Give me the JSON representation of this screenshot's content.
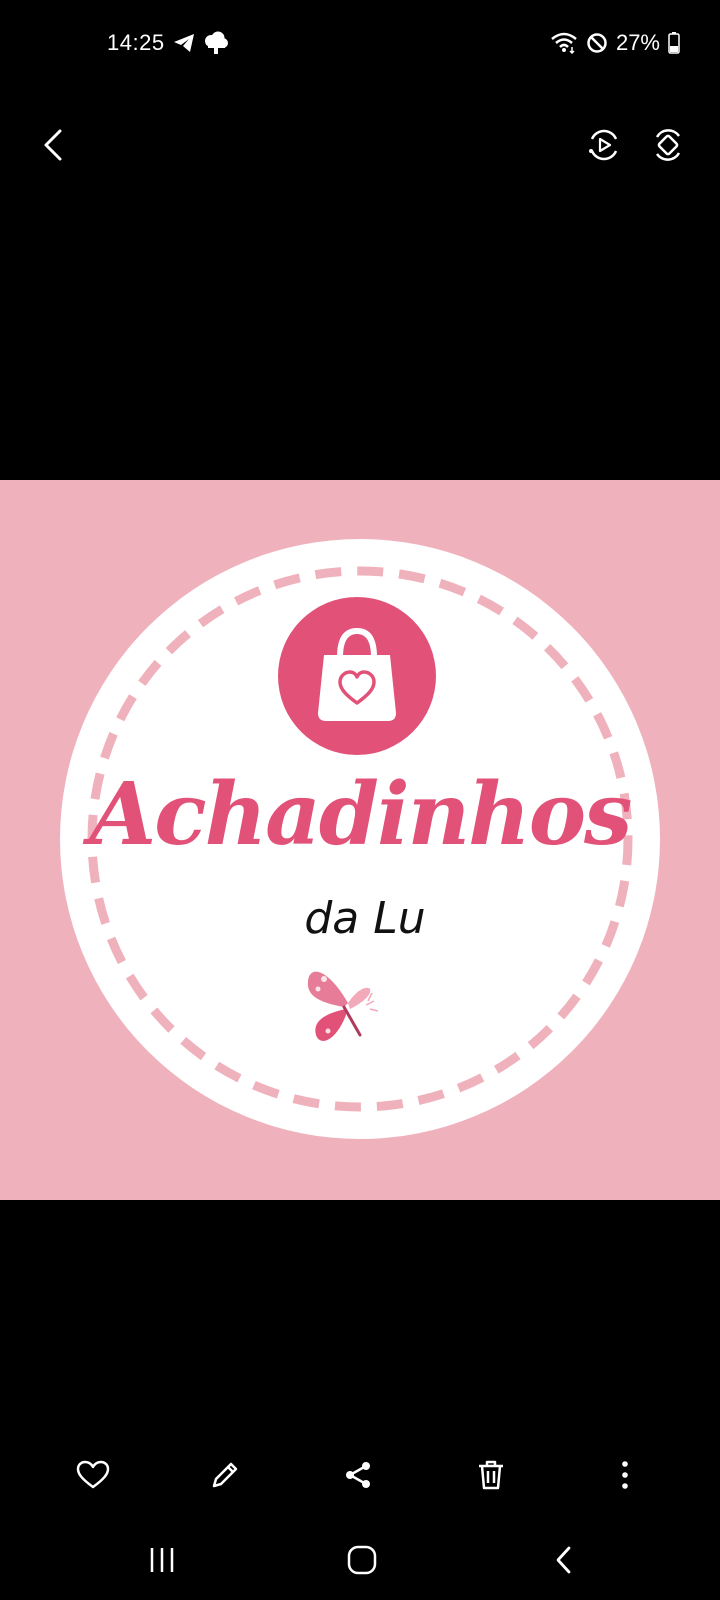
{
  "status_bar": {
    "time": "14:25",
    "battery": "27%",
    "icons": [
      "telegram-icon",
      "cloud-icon",
      "wifi-icon",
      "do-not-disturb-icon",
      "battery-icon"
    ]
  },
  "top_bar": {
    "icons": [
      "back-icon",
      "motion-photo-icon",
      "auto-rotate-icon"
    ]
  },
  "image": {
    "background": "#efb2bd",
    "accent": "#e25278",
    "brand_title": "Achadinhos",
    "brand_subtitle": "da Lu"
  },
  "action_bar": {
    "icons": [
      "favorite-icon",
      "edit-icon",
      "share-icon",
      "delete-icon",
      "more-icon"
    ]
  },
  "nav_bar": {
    "icons": [
      "recents-icon",
      "home-icon",
      "back-icon"
    ]
  }
}
